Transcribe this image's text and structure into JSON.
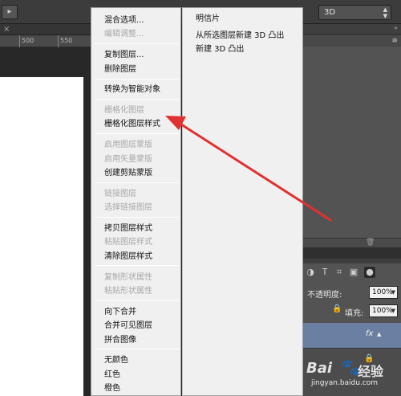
{
  "toolbar": {
    "mode_select_value": "3D",
    "mode_select_arrows": "▲▼"
  },
  "ruler": {
    "labels": [
      "500",
      "550"
    ]
  },
  "context_menu": {
    "items": [
      {
        "label": "混合选项...",
        "enabled": true
      },
      {
        "label": "编辑调整...",
        "enabled": false
      },
      {
        "label": "复制图层...",
        "enabled": true
      },
      {
        "label": "删除图层",
        "enabled": true
      },
      {
        "label": "转换为智能对象",
        "enabled": true
      },
      {
        "label": "栅格化图层",
        "enabled": false
      },
      {
        "label": "栅格化图层样式",
        "enabled": true
      },
      {
        "label": "启用图层蒙版",
        "enabled": false
      },
      {
        "label": "启用矢量蒙版",
        "enabled": false
      },
      {
        "label": "创建剪贴蒙版",
        "enabled": true
      },
      {
        "label": "链接图层",
        "enabled": false
      },
      {
        "label": "选择链接图层",
        "enabled": false
      },
      {
        "label": "拷贝图层样式",
        "enabled": true
      },
      {
        "label": "粘贴图层样式",
        "enabled": false
      },
      {
        "label": "清除图层样式",
        "enabled": true
      },
      {
        "label": "复制形状属性",
        "enabled": false
      },
      {
        "label": "粘贴形状属性",
        "enabled": false
      },
      {
        "label": "向下合并",
        "enabled": true
      },
      {
        "label": "合并可见图层",
        "enabled": true
      },
      {
        "label": "拼合图像",
        "enabled": true
      },
      {
        "label": "无颜色",
        "enabled": true
      },
      {
        "label": "红色",
        "enabled": true
      },
      {
        "label": "橙色",
        "enabled": true
      }
    ]
  },
  "submenu": {
    "items": [
      "明信片",
      "从所选图层新建 3D 凸出",
      "新建 3D 凸出"
    ]
  },
  "layers_panel": {
    "opacity_label": "不透明度:",
    "opacity_value": "100%",
    "fill_label": "填充:",
    "fill_value": "100%",
    "fx_label": "fx"
  },
  "watermark": {
    "logo": "Bai",
    "brand": "经验",
    "url": "jingyan.baidu.com"
  },
  "annotation": {
    "color": "#e03030"
  }
}
